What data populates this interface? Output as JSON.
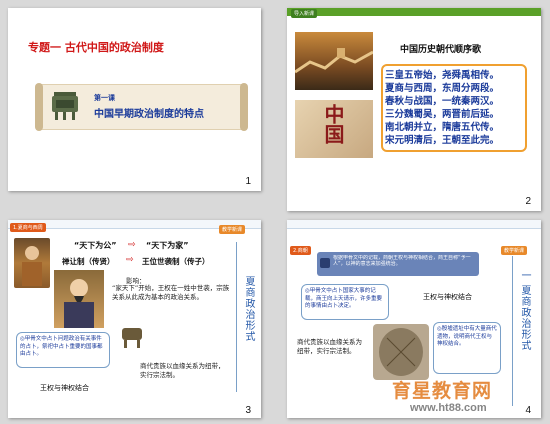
{
  "slide1": {
    "top_title": "专题一 古代中国的政治制度",
    "lesson": "第一课",
    "lesson_title": "中国早期政治制度的特点",
    "number": "1"
  },
  "slide2": {
    "tag": "导入新课",
    "heading": "中国历史朝代顺序歌",
    "poem": [
      "三皇五帝始，尧舜禹相传。",
      "夏商与西周，东周分两段。",
      "春秋与战国，一统秦两汉。",
      "三分魏蜀吴，两晋前后延。",
      "南北朝并立，隋唐五代传。",
      "宋元明清后，王朝至此完。"
    ],
    "character_art": "中国",
    "number": "2"
  },
  "slide3": {
    "tag": "1.夏商与西周",
    "corner_tag": "教学新课",
    "line1_a": "“天下为公”",
    "line1_b": "“天下为家”",
    "line2_a": "禅让制（传贤）",
    "line2_b": "王位世袭制（传子）",
    "influence_title": "影响：",
    "influence_text": "“家天下”开始，王权在一姓中世袭，宗族关系从此成为基本的政治关系。",
    "note_left": "◎甲骨文中占卜问题政治有关事件的占卜，祭祀中占卜重要的国事都由占卜。",
    "note_right": "商代贵族以血缘关系为纽带，实行宗法制。",
    "bottom": "王权与神权结合",
    "side_title": "夏商政治形式",
    "number": "3"
  },
  "slide4": {
    "tag": "2.商朝",
    "corner_tag": "教学新课",
    "banner": "根据甲骨文中的记载，商朝王权与神权相结合，商王自称“予一人”，以神的意志来加强统治。",
    "note_a": "◎甲骨文中占卜国家大事的记载，商王向上天请示，许多重要的事情由占卜决定。",
    "label_a": "王权与神权结合",
    "note_b": "商代贵族以血缘关系为纽带，实行宗法制。",
    "note_c": "◎殷墟遗址中有大量商代遗物，说明商代王权与神权结合。",
    "side_title": "一 夏商政治形式",
    "number": "4"
  },
  "watermark": {
    "text": "育星教育网",
    "url": "www.ht88.com"
  },
  "colors": {
    "title_red": "#d01818",
    "lesson_blue": "#1a3a9a",
    "accent_orange": "#e8892a",
    "accent_green": "#5aa028",
    "side_blue": "#2458a8"
  }
}
